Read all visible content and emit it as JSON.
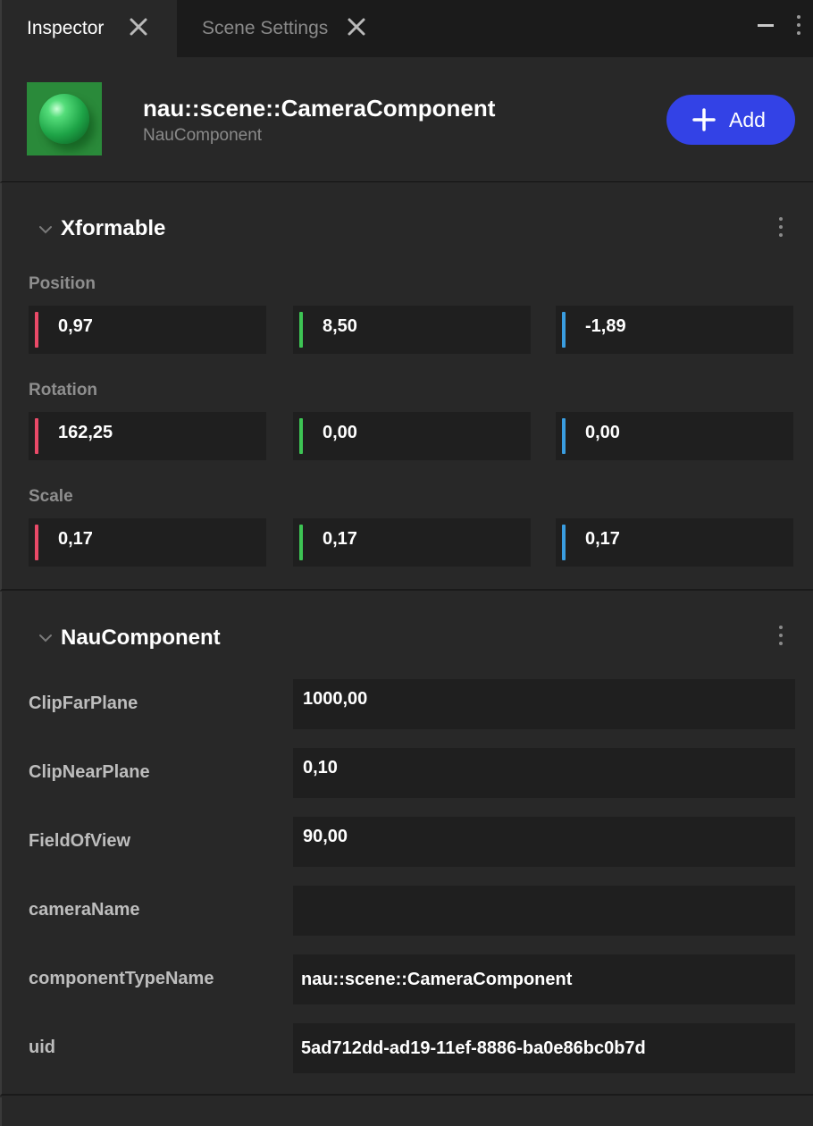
{
  "tabs": [
    {
      "label": "Inspector",
      "active": true
    },
    {
      "label": "Scene Settings",
      "active": false
    }
  ],
  "header": {
    "title": "nau::scene::CameraComponent",
    "subtitle": "NauComponent",
    "add_label": "Add",
    "add_color": "#3342e6"
  },
  "xformable": {
    "title": "Xformable",
    "position": {
      "label": "Position",
      "x": "0,97",
      "y": "8,50",
      "z": "-1,89"
    },
    "rotation": {
      "label": "Rotation",
      "x": "162,25",
      "y": "0,00",
      "z": "0,00"
    },
    "scale": {
      "label": "Scale",
      "x": "0,17",
      "y": "0,17",
      "z": "0,17"
    }
  },
  "nau_component": {
    "title": "NauComponent",
    "rows": [
      {
        "label": "ClipFarPlane",
        "value": "1000,00"
      },
      {
        "label": "ClipNearPlane",
        "value": "0,10"
      },
      {
        "label": "FieldOfView",
        "value": "90,00"
      },
      {
        "label": "cameraName",
        "value": ""
      },
      {
        "label": "componentTypeName",
        "value": "nau::scene::CameraComponent"
      },
      {
        "label": "uid",
        "value": "5ad712dd-ad19-11ef-8886-ba0e86bc0b7d"
      }
    ]
  },
  "axis_colors": {
    "x": "#ea4a68",
    "y": "#3dc454",
    "z": "#3a9de0"
  },
  "icons": {
    "tab_close": "close-icon",
    "minimize": "minimize-icon",
    "more": "more-vertical-icon",
    "collapse": "chevron-down-icon",
    "add": "plus-icon"
  }
}
